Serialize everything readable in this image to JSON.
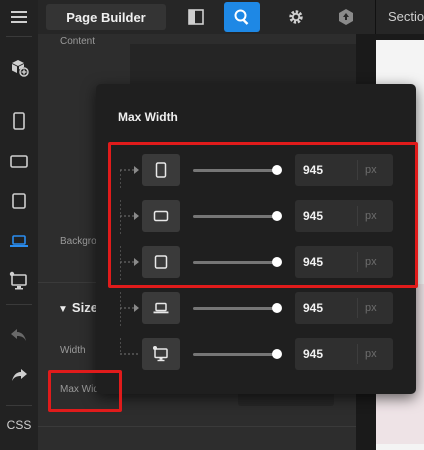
{
  "topbar": {
    "app_title": "Page Builder",
    "sections_tab": "Section"
  },
  "rail": {
    "css_label": "CSS"
  },
  "panel": {
    "content_label": "Content",
    "background_label": "Backgro",
    "size_heading": "Size",
    "width_label": "Width",
    "max_width_label": "Max Wid"
  },
  "popover": {
    "title": "Max Width",
    "rows": [
      {
        "device": "tablet-portrait-icon",
        "value": "945",
        "unit": "px"
      },
      {
        "device": "tablet-landscape-icon",
        "value": "945",
        "unit": "px"
      },
      {
        "device": "square-device-icon",
        "value": "945",
        "unit": "px"
      },
      {
        "device": "laptop-icon",
        "value": "945",
        "unit": "px"
      },
      {
        "device": "desktop-icon",
        "value": "945",
        "unit": "px"
      }
    ]
  },
  "colors": {
    "accent": "#1e88e5",
    "annotation": "#e01b1b"
  }
}
